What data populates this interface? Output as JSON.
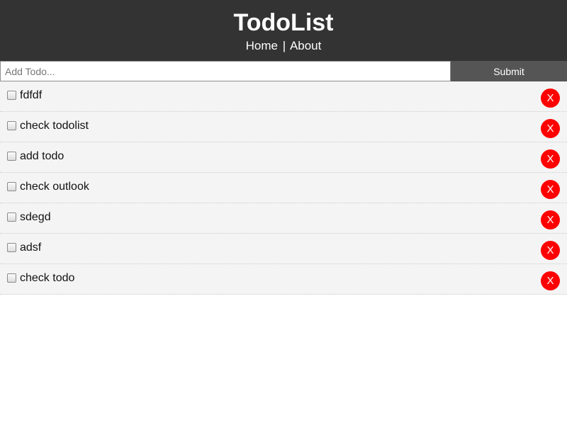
{
  "header": {
    "title": "TodoList",
    "nav": {
      "home": "Home",
      "separator": "|",
      "about": "About"
    }
  },
  "add_form": {
    "placeholder": "Add Todo...",
    "value": "",
    "submit_label": "Submit"
  },
  "todos": [
    {
      "title": "fdfdf",
      "completed": false,
      "delete_label": "X"
    },
    {
      "title": "check todolist",
      "completed": false,
      "delete_label": "X"
    },
    {
      "title": "add todo",
      "completed": false,
      "delete_label": "X"
    },
    {
      "title": "check outlook",
      "completed": false,
      "delete_label": "X"
    },
    {
      "title": "sdegd",
      "completed": false,
      "delete_label": "X"
    },
    {
      "title": "adsf",
      "completed": false,
      "delete_label": "X"
    },
    {
      "title": "check todo",
      "completed": false,
      "delete_label": "X"
    }
  ],
  "colors": {
    "header_bg": "#333333",
    "submit_bg": "#555555",
    "item_bg": "#f4f4f4",
    "delete_bg": "#ff0000"
  }
}
